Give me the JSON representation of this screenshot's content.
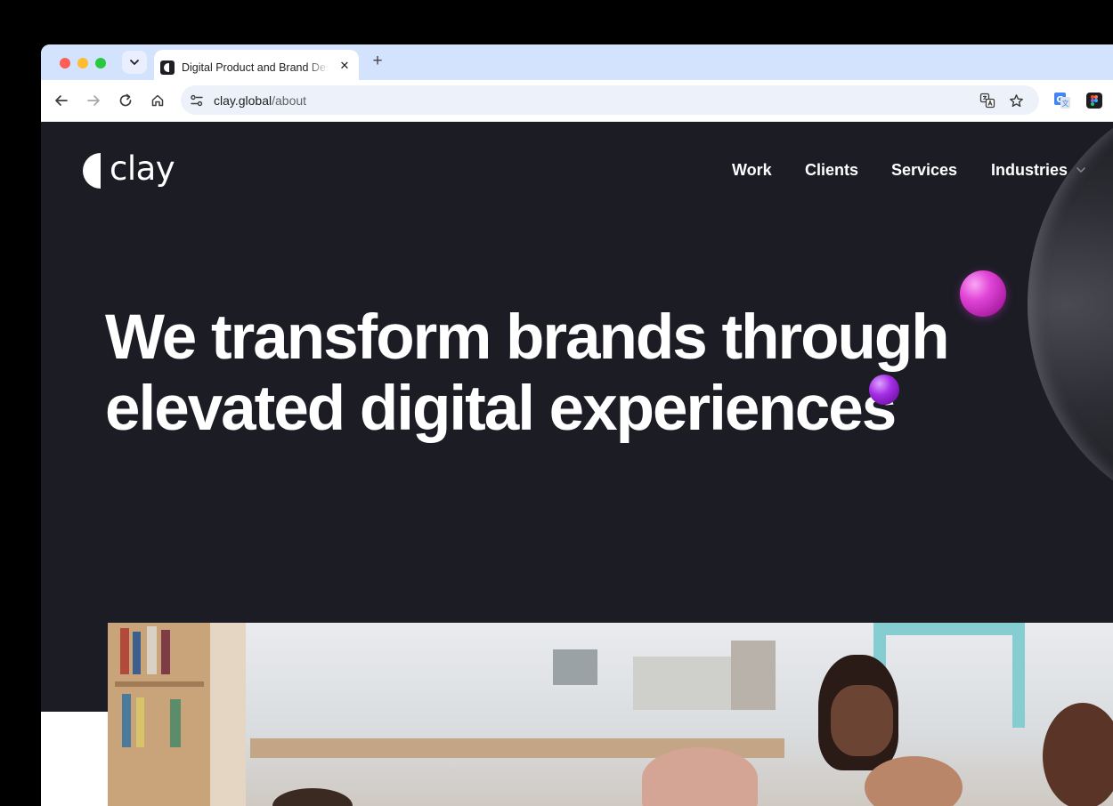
{
  "browser": {
    "tab": {
      "title": "Digital Product and Brand Design Agency"
    },
    "address": {
      "domain": "clay.global",
      "path": "/about"
    },
    "icons": {
      "tab_search": "chevron-down-icon",
      "tab_close": "close-icon",
      "new_tab": "plus-icon",
      "back": "arrow-left-icon",
      "forward": "arrow-right-icon",
      "reload": "reload-icon",
      "home": "home-icon",
      "site_info": "tune-icon",
      "translate": "translate-icon",
      "bookmark": "star-icon",
      "ext_translate": "google-translate-icon",
      "ext_figma": "figma-icon"
    },
    "glyphs": {
      "close": "✕",
      "plus": "+"
    }
  },
  "site": {
    "logo": "clay",
    "nav": [
      "Work",
      "Clients",
      "Services",
      "Industries"
    ],
    "headline_line1": "We transform brands through",
    "headline_line2": "elevated digital experiences"
  },
  "colors": {
    "hero_bg": "#1b1c24",
    "accent_pink": "#e145d6",
    "accent_purple": "#a52ee6",
    "tabstrip_bg": "#d3e3fd"
  }
}
